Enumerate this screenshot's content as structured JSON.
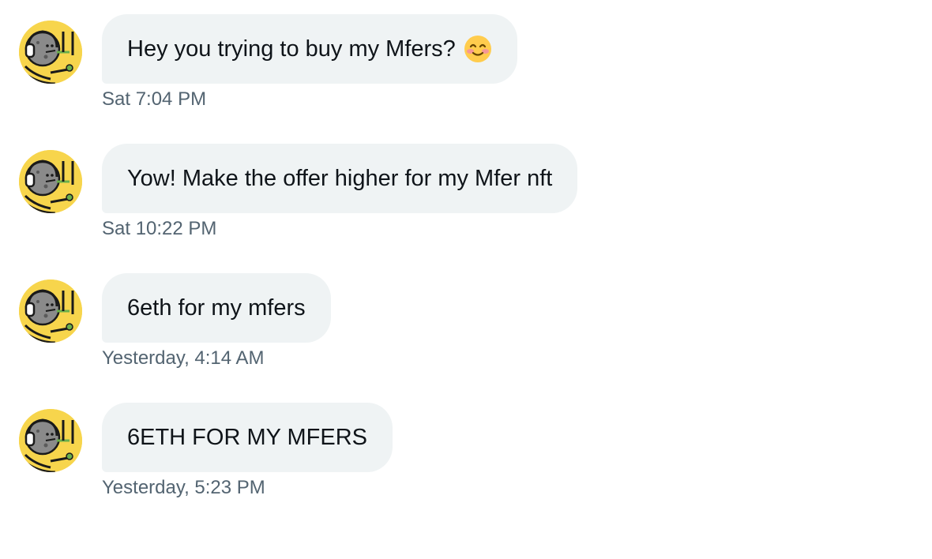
{
  "messages": [
    {
      "text": "Hey you trying to buy my Mfers?",
      "emoji": "smiling-face-with-smiling-eyes",
      "timestamp": "Sat 7:04 PM"
    },
    {
      "text": "Yow! Make the offer higher for my Mfer nft",
      "timestamp": "Sat 10:22 PM"
    },
    {
      "text": "6eth for my mfers",
      "timestamp": "Yesterday, 4:14 AM"
    },
    {
      "text": "6ETH FOR MY MFERS",
      "timestamp": "Yesterday, 5:23 PM"
    }
  ],
  "avatar": {
    "icon": "mfer-avatar-icon",
    "background": "#f7d54c"
  },
  "colors": {
    "bubble": "#eff3f4",
    "text": "#0f1419",
    "timestamp": "#536471"
  }
}
